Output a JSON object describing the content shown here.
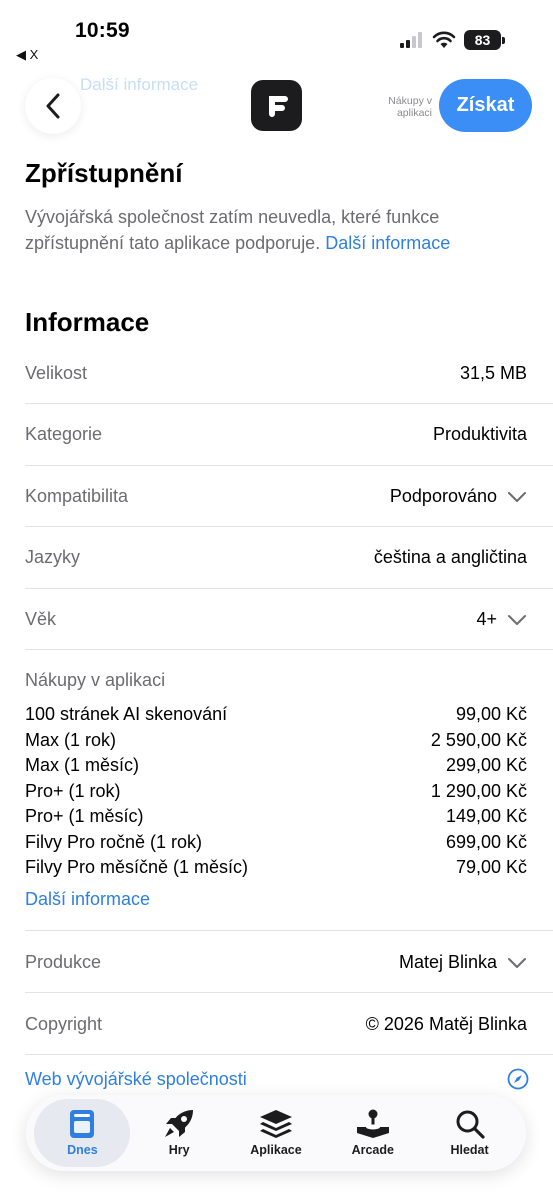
{
  "ghost_text": {
    "line1": "Další informace",
    "link": "Další informace"
  },
  "status_bar": {
    "time": "10:59",
    "back_app": "◀ X",
    "battery": "83"
  },
  "nav": {
    "iap_note": "Nákupy v aplikaci",
    "get_button": "Získat"
  },
  "accessibility": {
    "title": "Zpřístupnění",
    "description": "Vývojářská společnost zatím neuvedla, které funkce zpřístupnění tato aplikace podporuje.",
    "link": "Další informace"
  },
  "information": {
    "title": "Informace",
    "rows": [
      {
        "label": "Velikost",
        "value": "31,5 MB"
      },
      {
        "label": "Kategorie",
        "value": "Produktivita"
      },
      {
        "label": "Kompatibilita",
        "value": "Podporováno"
      },
      {
        "label": "Jazyky",
        "value": "čeština a angličtina"
      },
      {
        "label": "Věk",
        "value": "4+"
      }
    ],
    "iap_title": "Nákupy v aplikaci",
    "iap_items": [
      {
        "name": "100 stránek AI skenování",
        "price": "99,00 Kč"
      },
      {
        "name": "Max (1 rok)",
        "price": "2 590,00 Kč"
      },
      {
        "name": "Max (1 měsíc)",
        "price": "299,00 Kč"
      },
      {
        "name": "Pro+ (1 rok)",
        "price": "1 290,00 Kč"
      },
      {
        "name": "Pro+ (1 měsíc)",
        "price": "149,00 Kč"
      },
      {
        "name": "Filvy Pro ročně (1 rok)",
        "price": "699,00 Kč"
      },
      {
        "name": "Filvy Pro měsíčně (1 měsíc)",
        "price": "79,00 Kč"
      }
    ],
    "iap_more": "Další informace",
    "producer_label": "Produkce",
    "producer_value": "Matej Blinka",
    "copyright_label": "Copyright",
    "copyright_value": "© 2026 Matěj Blinka",
    "website_link": "Web vývojářské společnosti"
  },
  "tabbar": {
    "tabs": [
      {
        "label": "Dnes",
        "icon": "today-icon",
        "active": true
      },
      {
        "label": "Hry",
        "icon": "rocket-icon",
        "active": false
      },
      {
        "label": "Aplikace",
        "icon": "apps-stack-icon",
        "active": false
      },
      {
        "label": "Arcade",
        "icon": "joystick-icon",
        "active": false
      },
      {
        "label": "Hledat",
        "icon": "search-icon",
        "active": false
      }
    ]
  },
  "colors": {
    "accent": "#3a8ef6",
    "link": "#2f7fe0",
    "secondary_text": "#6c6c70",
    "divider": "#e3e3e7"
  }
}
